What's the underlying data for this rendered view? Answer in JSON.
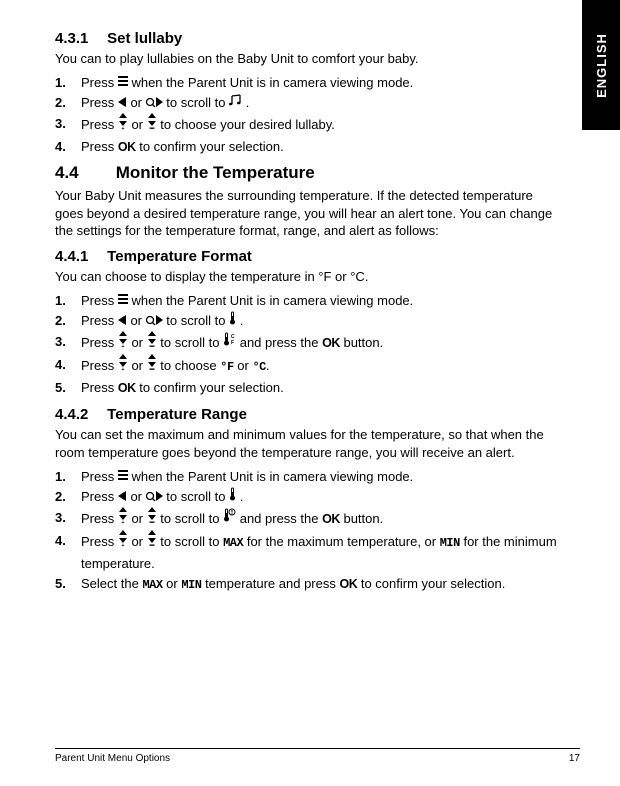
{
  "sideTab": "ENGLISH",
  "sections": {
    "s431": {
      "num": "4.3.1",
      "title": "Set lullaby",
      "intro": "You can to play lullabies on the Baby Unit to comfort your baby.",
      "steps": {
        "s1a": "Press ",
        "s1b": " when the Parent Unit is in camera viewing mode.",
        "s2a": "Press ",
        "s2b": " or  ",
        "s2c": "  to scroll to ",
        "s2d": " .",
        "s3a": "Press  ",
        "s3b": "  or  ",
        "s3c": "  to choose your desired lullaby.",
        "s4a": "Press ",
        "s4b": " to confirm your selection."
      }
    },
    "s44": {
      "num": "4.4",
      "title": "Monitor the Temperature",
      "intro": "Your Baby Unit measures the surrounding temperature. If the detected temperature goes beyond a desired temperature range, you will hear an alert tone. You can change the settings for the temperature format, range, and alert as follows:"
    },
    "s441": {
      "num": "4.4.1",
      "title": "Temperature Format",
      "intro": "You can choose to display the temperature in °F or °C.",
      "steps": {
        "s1a": "Press ",
        "s1b": " when the Parent Unit is in camera viewing mode.",
        "s2a": "Press ",
        "s2b": " or  ",
        "s2c": "  to scroll to  ",
        "s2d": " .",
        "s3a": "Press  ",
        "s3b": "  or  ",
        "s3c": "  to scroll to ",
        "s3d": " and press the ",
        "s3e": "  button.",
        "s4a": "Press  ",
        "s4b": "  or  ",
        "s4c": "  to choose ",
        "s4d": " or ",
        "s4e": ".",
        "s5a": "Press ",
        "s5b": " to confirm your selection."
      }
    },
    "s442": {
      "num": "4.4.2",
      "title": "Temperature Range",
      "intro": "You can set the maximum and minimum values for the temperature, so that when the room temperature goes beyond the temperature range, you will receive an alert.",
      "steps": {
        "s1a": "Press ",
        "s1b": " when the Parent Unit is in camera viewing mode.",
        "s2a": "Press ",
        "s2b": " or  ",
        "s2c": "  to scroll to  ",
        "s2d": " .",
        "s3a": "Press  ",
        "s3b": "  or  ",
        "s3c": "  to scroll to ",
        "s3d": " and press the ",
        "s3e": "  button.",
        "s4a": "Press  ",
        "s4b": "  or  ",
        "s4c": "  to scroll to ",
        "s4d": " for the maximum temperature, or ",
        "s4e": " for the minimum temperature.",
        "s5a": "Select the ",
        "s5b": " or ",
        "s5c": " temperature and press ",
        "s5d": "  to confirm your selection."
      }
    }
  },
  "labels": {
    "ok": "OK",
    "degF_digital": "℉",
    "degC_digital": "℃",
    "degF_digital2": "°F",
    "degC_digital2": "°C",
    "max": "MAX",
    "min": "MIN"
  },
  "footer": {
    "title": "Parent Unit Menu Options",
    "page": "17"
  }
}
